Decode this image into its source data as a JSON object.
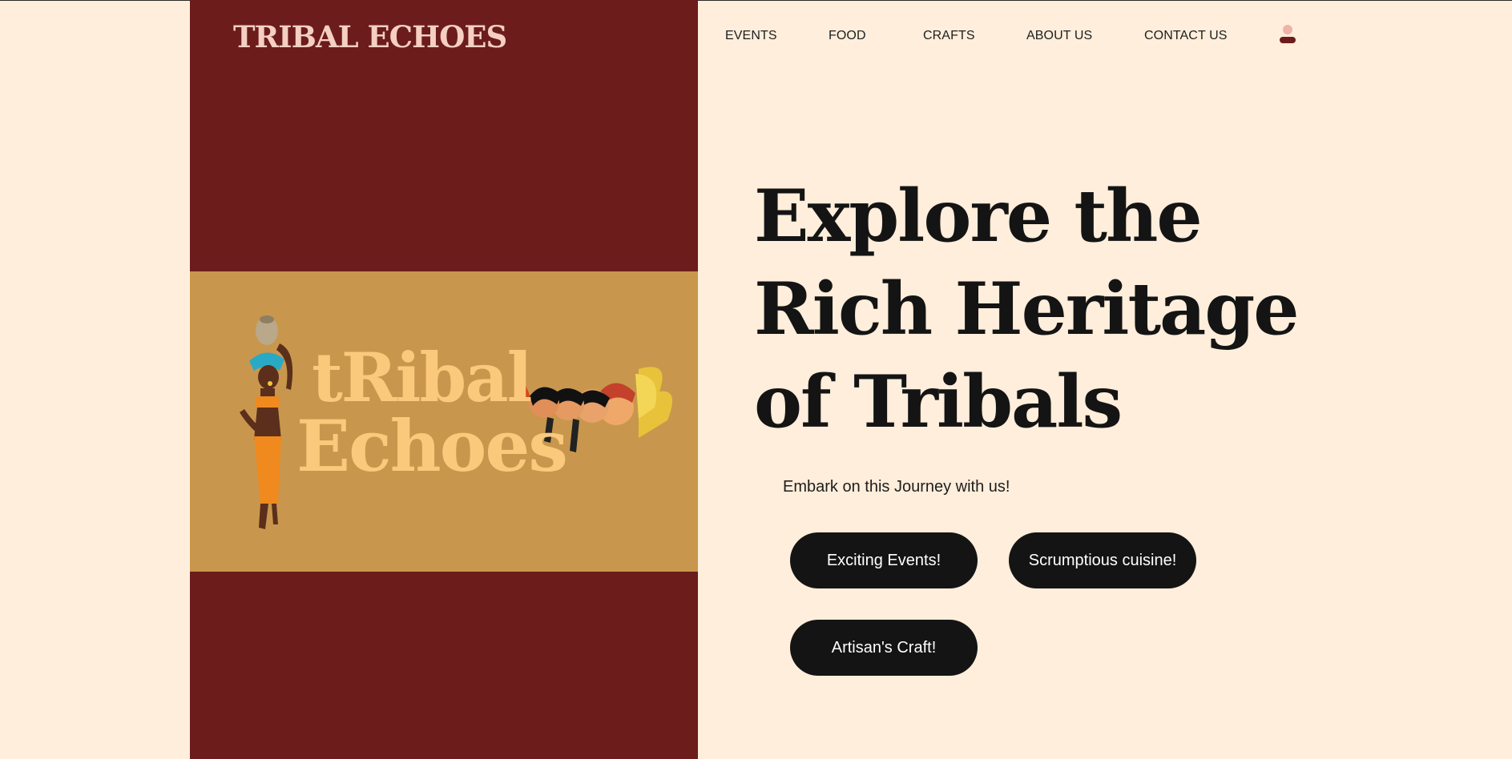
{
  "brand": {
    "name": "TRIBAL ECHOES"
  },
  "nav": {
    "items": [
      {
        "label": "EVENTS"
      },
      {
        "label": "FOOD"
      },
      {
        "label": "CRAFTS"
      },
      {
        "label": "ABOUT US"
      },
      {
        "label": "CONTACT US"
      }
    ],
    "profile_icon": "user-icon"
  },
  "banner": {
    "logo_line1": "tRibal",
    "logo_line2": "Echoes"
  },
  "hero": {
    "title_lines": [
      "Explore the",
      "Rich Heritage",
      "of Tribals"
    ],
    "tagline": "Embark on this Journey with us!",
    "buttons": [
      {
        "label": "Exciting Events!"
      },
      {
        "label": "Scrumptious cuisine!"
      },
      {
        "label": "Artisan's Craft!"
      }
    ]
  },
  "colors": {
    "page_bg": "#feeedb",
    "left_panel": "#6b1c1b",
    "banner_bg": "#c8974d",
    "logo_text": "#fbc97c",
    "brand_text": "#f4cfc2",
    "button_bg": "#141414",
    "button_text": "#ffffff"
  }
}
